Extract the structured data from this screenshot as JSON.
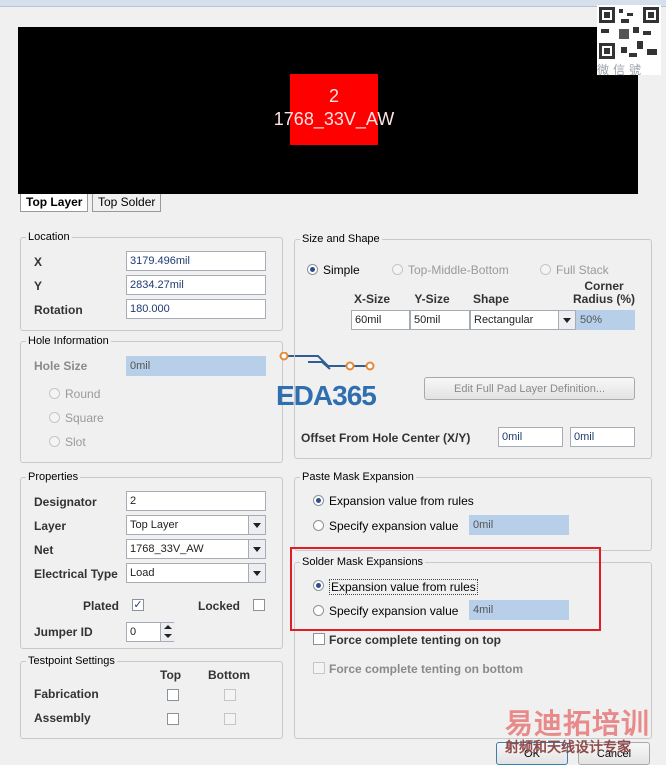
{
  "preview": {
    "pad_number": "2",
    "pad_net": "1768_33V_AW",
    "tabs": [
      "Top Layer",
      "Top Solder"
    ]
  },
  "watermark": {
    "qr_caption": "微信號",
    "eda_logo": "EDA365",
    "bottom_brand": "易迪拓培训",
    "bottom_brand_sub": "射频和天线设计专家"
  },
  "location": {
    "title": "Location",
    "x_label": "X",
    "x_value": "3179.496mil",
    "y_label": "Y",
    "y_value": "2834.27mil",
    "rotation_label": "Rotation",
    "rotation_value": "180.000"
  },
  "hole": {
    "title": "Hole Information",
    "size_label": "Hole Size",
    "size_value": "0mil",
    "options": [
      "Round",
      "Square",
      "Slot"
    ]
  },
  "properties": {
    "title": "Properties",
    "designator_label": "Designator",
    "designator_value": "2",
    "layer_label": "Layer",
    "layer_value": "Top Layer",
    "net_label": "Net",
    "net_value": "1768_33V_AW",
    "etype_label": "Electrical Type",
    "etype_value": "Load",
    "plated_label": "Plated",
    "plated_checked": true,
    "locked_label": "Locked",
    "locked_checked": false,
    "jumper_label": "Jumper ID",
    "jumper_value": "0"
  },
  "testpoint": {
    "title": "Testpoint Settings",
    "col_top": "Top",
    "col_bottom": "Bottom",
    "fabrication_label": "Fabrication",
    "assembly_label": "Assembly"
  },
  "size_shape": {
    "title": "Size and Shape",
    "modes": [
      "Simple",
      "Top-Middle-Bottom",
      "Full Stack"
    ],
    "selected_mode": "Simple",
    "col_xsize": "X-Size",
    "col_ysize": "Y-Size",
    "col_shape": "Shape",
    "col_corner": "Corner Radius (%)",
    "xsize": "60mil",
    "ysize": "50mil",
    "shape": "Rectangular",
    "corner": "50%",
    "edit_button": "Edit Full Pad Layer Definition...",
    "offset_label": "Offset From Hole Center (X/Y)",
    "offset_x": "0mil",
    "offset_y": "0mil"
  },
  "paste_mask": {
    "title": "Paste Mask Expansion",
    "opt_rules": "Expansion value from rules",
    "opt_specify": "Specify expansion value",
    "value": "0mil",
    "selected": "rules"
  },
  "solder_mask": {
    "title": "Solder Mask Expansions",
    "opt_rules": "Expansion value from rules",
    "opt_specify": "Specify expansion value",
    "value": "4mil",
    "selected": "rules",
    "tent_top": "Force complete tenting on top",
    "tent_bottom": "Force complete tenting on bottom"
  },
  "buttons": {
    "ok": "OK",
    "cancel": "Cancel"
  }
}
